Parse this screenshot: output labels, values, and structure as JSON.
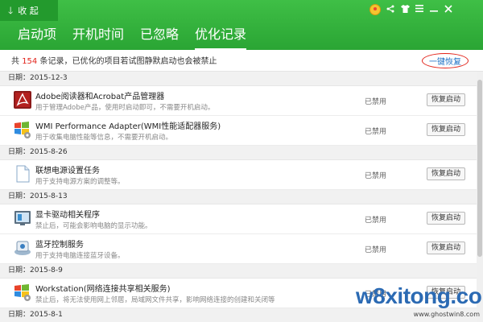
{
  "header": {
    "collapse_label": "收 起",
    "tabs": [
      {
        "label": "启动项"
      },
      {
        "label": "开机时间"
      },
      {
        "label": "已忽略"
      },
      {
        "label": "优化记录",
        "active": true
      }
    ],
    "window_icons": [
      "medal-icon",
      "share-icon",
      "shirt-icon",
      "menu-icon",
      "minimize-icon",
      "close-icon"
    ]
  },
  "info": {
    "prefix": "共 ",
    "count": "154",
    "suffix": " 条记录，已优化的项目若试图静默启动也会被禁止",
    "restore_all": "一键恢复"
  },
  "groups": [
    {
      "date": "日期：2015-12-3",
      "items": [
        {
          "icon": "acrobat-icon",
          "name": "Adobe阅读器和Acrobat产品管理器",
          "desc": "用于管理Adobe产品，使用时启动即可，不需要开机启动。",
          "status": "已禁用",
          "button": "恢复启动"
        },
        {
          "icon": "windows-service-icon",
          "name": "WMI Performance Adapter(WMI性能适配器服务)",
          "desc": "用于收集电脑性能等信息，不需要开机启动。",
          "status": "已禁用",
          "button": "恢复启动"
        }
      ]
    },
    {
      "date": "日期：2015-8-26",
      "items": [
        {
          "icon": "document-icon",
          "name": "联想电源设置任务",
          "desc": "用于支持电源方案的调整等。",
          "status": "已禁用",
          "button": "恢复启动"
        }
      ]
    },
    {
      "date": "日期：2015-8-13",
      "items": [
        {
          "icon": "display-driver-icon",
          "name": "显卡驱动相关程序",
          "desc": "禁止后，可能会影响电脑的显示功能。",
          "status": "已禁用",
          "button": "恢复启动"
        },
        {
          "icon": "bluetooth-service-icon",
          "name": "蓝牙控制服务",
          "desc": "用于支持电脑连接蓝牙设备。",
          "status": "已禁用",
          "button": "恢复启动"
        }
      ]
    },
    {
      "date": "日期：2015-8-9",
      "items": [
        {
          "icon": "windows-service-icon",
          "name": "Workstation(网络连接共享相关服务)",
          "desc": "禁止后，将无法使用网上邻居，局域网文件共享，影响网络连接的创建和关闭等",
          "status": "已禁用",
          "button": "恢复启动"
        }
      ]
    },
    {
      "date": "日期：2015-8-1",
      "items": []
    }
  ],
  "watermark": {
    "main": "w8xitong.com",
    "sub": "www.ghostwin8.com"
  },
  "colors": {
    "header_green": "#2aa534",
    "count_red": "#e2231a",
    "link_blue": "#1a6fc4"
  }
}
